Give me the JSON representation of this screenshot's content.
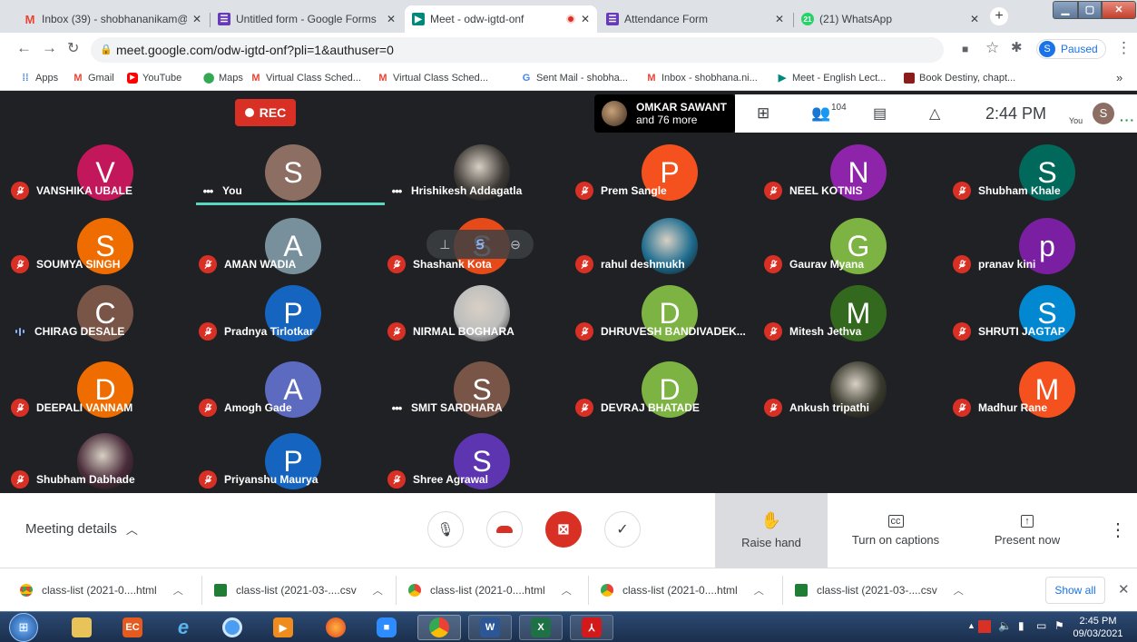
{
  "browser": {
    "tabs": [
      {
        "title": "Inbox (39) - shobhananikam@a",
        "icon": "gmail-icon",
        "color": "#ea4335",
        "active": false
      },
      {
        "title": "Untitled form - Google Forms",
        "icon": "forms-icon",
        "color": "#673ab7",
        "active": false
      },
      {
        "title": "Meet - odw-igtd-onf",
        "icon": "meet-icon",
        "color": "#00897b",
        "active": true
      },
      {
        "title": "Attendance Form",
        "icon": "forms-icon",
        "color": "#673ab7",
        "active": false
      },
      {
        "title": "(21) WhatsApp",
        "icon": "whatsapp-icon",
        "color": "#25d366",
        "active": false
      }
    ],
    "url": "meet.google.com/odw-igtd-onf?pli=1&authuser=0",
    "profile_initial": "S",
    "profile_status": "Paused",
    "bookmarks": [
      {
        "label": "Apps",
        "icon": "apps-grid-icon"
      },
      {
        "label": "Gmail",
        "icon": "gmail-icon"
      },
      {
        "label": "YouTube",
        "icon": "youtube-icon"
      },
      {
        "label": "Maps",
        "icon": "maps-icon"
      },
      {
        "label": "Virtual Class Sched...",
        "icon": "gmail-icon"
      },
      {
        "label": "Virtual Class Sched...",
        "icon": "gmail-icon"
      },
      {
        "label": "Sent Mail - shobha...",
        "icon": "google-icon"
      },
      {
        "label": "Inbox - shobhana.ni...",
        "icon": "gmail-icon"
      },
      {
        "label": "Meet - English Lect...",
        "icon": "meet-icon"
      },
      {
        "label": "Book Destiny, chapt...",
        "icon": "book-icon"
      }
    ],
    "bookmarks_overflow": "»"
  },
  "meet": {
    "rec_label": "REC",
    "presenter": {
      "name": "OMKAR SAWANT",
      "more": "and 76 more"
    },
    "participant_count": "104",
    "time": "2:44 PM",
    "self_label": "You",
    "self_initial": "S",
    "participants": [
      {
        "initial": "V",
        "name": "VANSHIKA UBALE",
        "color": "#c2185b",
        "state": "muted"
      },
      {
        "initial": "S",
        "name": "You",
        "color": "#8d6e63",
        "state": "dots"
      },
      {
        "initial": "",
        "name": "Hrishikesh Addagatla",
        "color": "#3e3a36",
        "state": "dots",
        "photo": true
      },
      {
        "initial": "P",
        "name": "Prem Sangle",
        "color": "#f4511e",
        "state": "muted"
      },
      {
        "initial": "N",
        "name": "NEEL KOTNIS",
        "color": "#8e24aa",
        "state": "muted"
      },
      {
        "initial": "S",
        "name": "Shubham Khale",
        "color": "#00695c",
        "state": "muted"
      },
      {
        "initial": "S",
        "name": "SOUMYA SINGH",
        "color": "#ef6c00",
        "state": "muted"
      },
      {
        "initial": "A",
        "name": "AMAN WADIA",
        "color": "#78909c",
        "state": "muted"
      },
      {
        "initial": "S",
        "name": "Shashank Kota",
        "color": "#e64a19",
        "state": "muted"
      },
      {
        "initial": "",
        "name": "rahul deshmukh",
        "color": "#1e6d8f",
        "state": "muted",
        "photo": true
      },
      {
        "initial": "G",
        "name": "Gaurav Myana",
        "color": "#7cb342",
        "state": "muted"
      },
      {
        "initial": "p",
        "name": "pranav kini",
        "color": "#7b1fa2",
        "state": "muted"
      },
      {
        "initial": "C",
        "name": "CHIRAG DESALE",
        "color": "#795548",
        "state": "speaking"
      },
      {
        "initial": "P",
        "name": "Pradnya Tirlotkar",
        "color": "#1565c0",
        "state": "muted"
      },
      {
        "initial": "",
        "name": "NIRMAL BOGHARA",
        "color": "#bdbdbd",
        "state": "muted",
        "photo": true
      },
      {
        "initial": "D",
        "name": "DHRUVESH BANDIVADEK...",
        "color": "#7cb342",
        "state": "muted"
      },
      {
        "initial": "M",
        "name": "Mitesh Jethva",
        "color": "#33691e",
        "state": "muted"
      },
      {
        "initial": "S",
        "name": "SHRUTI JAGTAP",
        "color": "#0288d1",
        "state": "muted"
      },
      {
        "initial": "D",
        "name": "DEEPALI VANNAM",
        "color": "#ef6c00",
        "state": "muted"
      },
      {
        "initial": "A",
        "name": "Amogh Gade",
        "color": "#5c6bc0",
        "state": "muted"
      },
      {
        "initial": "S",
        "name": "SMIT SARDHARA",
        "color": "#795548",
        "state": "dots"
      },
      {
        "initial": "D",
        "name": "DEVRAJ BHATADE",
        "color": "#7cb342",
        "state": "muted"
      },
      {
        "initial": "",
        "name": "Ankush tripathi",
        "color": "#3a3a2e",
        "state": "muted",
        "photo": true
      },
      {
        "initial": "M",
        "name": "Madhur Rane",
        "color": "#f4511e",
        "state": "muted"
      },
      {
        "initial": "",
        "name": "Shubham Dabhade",
        "color": "#4a2c3a",
        "state": "muted",
        "photo": true
      },
      {
        "initial": "P",
        "name": "Priyanshu Maurya",
        "color": "#1565c0",
        "state": "muted"
      },
      {
        "initial": "S",
        "name": "Shree Agrawal",
        "color": "#5e35b1",
        "state": "muted"
      }
    ],
    "bottom": {
      "meeting_details": "Meeting details",
      "raise_hand": "Raise hand",
      "captions": "Turn on captions",
      "present": "Present now"
    }
  },
  "downloads": {
    "items": [
      {
        "name": "class-list (2021-0....html",
        "icon": "chrome-icon"
      },
      {
        "name": "class-list (2021-03-....csv",
        "icon": "csv-file-icon"
      },
      {
        "name": "class-list (2021-0....html",
        "icon": "chrome-icon"
      },
      {
        "name": "class-list (2021-0....html",
        "icon": "chrome-icon"
      },
      {
        "name": "class-list (2021-03-....csv",
        "icon": "csv-file-icon"
      }
    ],
    "show_all": "Show all"
  },
  "taskbar": {
    "time": "2:45 PM",
    "date": "09/03/2021"
  }
}
